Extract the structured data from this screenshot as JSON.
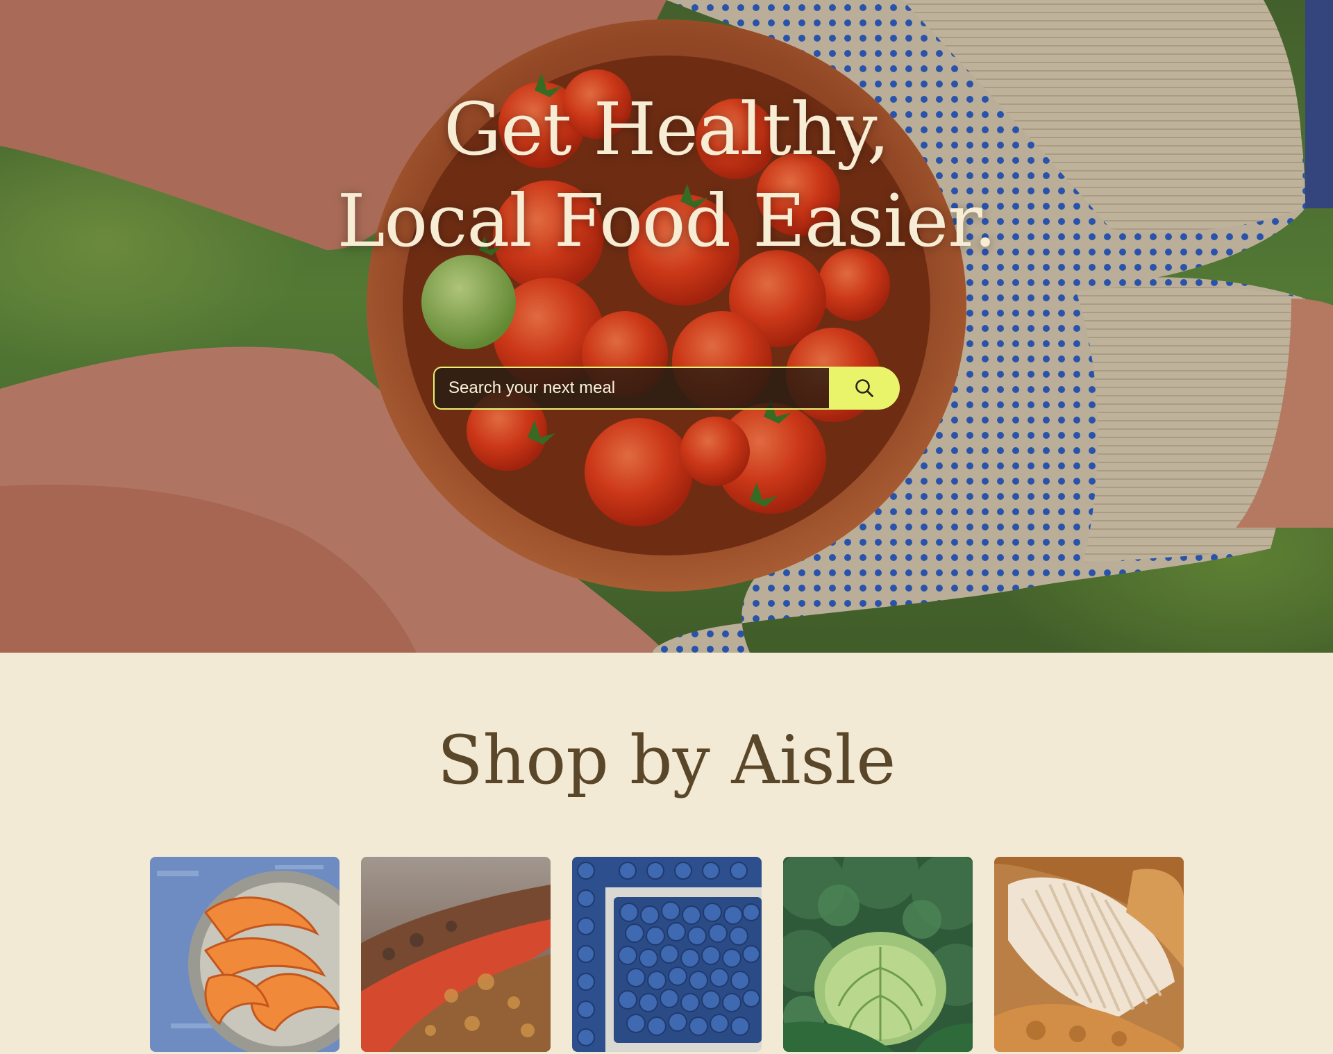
{
  "hero": {
    "title_line1": "Get Healthy,",
    "title_line2": "Local Food Easier.",
    "search": {
      "placeholder": "Search your next meal",
      "button_icon": "search-icon"
    }
  },
  "aisles": {
    "title": "Shop by Aisle",
    "tiles": [
      {
        "icon": "shrimp-image"
      },
      {
        "icon": "grilled-meat-image"
      },
      {
        "icon": "blueberries-image"
      },
      {
        "icon": "cabbage-kale-image"
      },
      {
        "icon": "muffin-image"
      }
    ]
  },
  "colors": {
    "background": "#f3ead6",
    "heading": "#5a4628",
    "hero_text": "#f7ecd4",
    "accent": "#e9f46a"
  }
}
